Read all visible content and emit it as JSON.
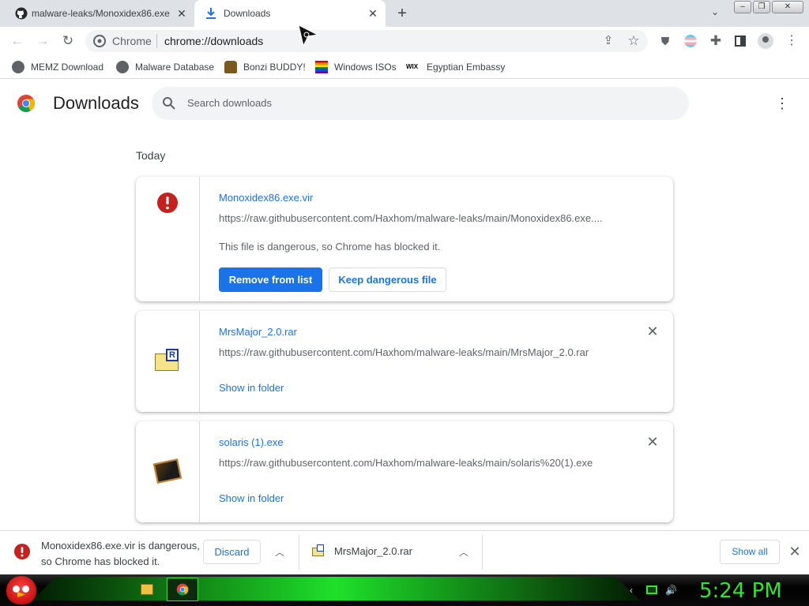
{
  "tabs": [
    {
      "label": "malware-leaks/Monoxidex86.exe",
      "icon": "github-icon"
    },
    {
      "label": "Downloads",
      "icon": "download-icon"
    }
  ],
  "window": {
    "minimize": "–",
    "restore": "❐",
    "close": "✕"
  },
  "toolbar": {
    "site_label": "Chrome",
    "url": "chrome://downloads"
  },
  "bookmarks": [
    {
      "label": "MEMZ Download",
      "icon": "globe-icon"
    },
    {
      "label": "Malware Database",
      "icon": "globe-icon"
    },
    {
      "label": "Bonzi BUDDY!",
      "icon": "bonzi-icon"
    },
    {
      "label": "Windows ISOs",
      "icon": "windows-flag-icon"
    },
    {
      "label": "Egyptian Embassy",
      "icon": "wix-icon",
      "badge": "WIX"
    }
  ],
  "page": {
    "title": "Downloads",
    "search_placeholder": "Search downloads",
    "section_label": "Today"
  },
  "downloads": [
    {
      "name": "Monoxidex86.exe.vir",
      "url": "https://raw.githubusercontent.com/Haxhom/malware-leaks/main/Monoxidex86.exe....",
      "warning": "This file is dangerous, so Chrome has blocked it.",
      "primary_action": "Remove from list",
      "secondary_action": "Keep dangerous file",
      "icon": "danger-icon"
    },
    {
      "name": "MrsMajor_2.0.rar",
      "url": "https://raw.githubusercontent.com/Haxhom/malware-leaks/main/MrsMajor_2.0.rar",
      "action": "Show in folder",
      "icon": "rar-archive-icon",
      "badge": "R"
    },
    {
      "name": "solaris (1).exe",
      "url": "https://raw.githubusercontent.com/Haxhom/malware-leaks/main/solaris%20(1).exe",
      "action": "Show in folder",
      "icon": "executable-icon"
    }
  ],
  "shelf": {
    "warning_line1": "Monoxidex86.exe.vir is dangerous,",
    "warning_line2": "so Chrome has blocked it.",
    "discard": "Discard",
    "item2": "MrsMajor_2.0.rar",
    "show_all": "Show all"
  },
  "taskbar": {
    "clock": "5:24 PM"
  },
  "colors": {
    "accent": "#1a73e8",
    "danger": "#c5221f",
    "clock": "#2ee62e",
    "tabstrip": "#dee1e6"
  }
}
